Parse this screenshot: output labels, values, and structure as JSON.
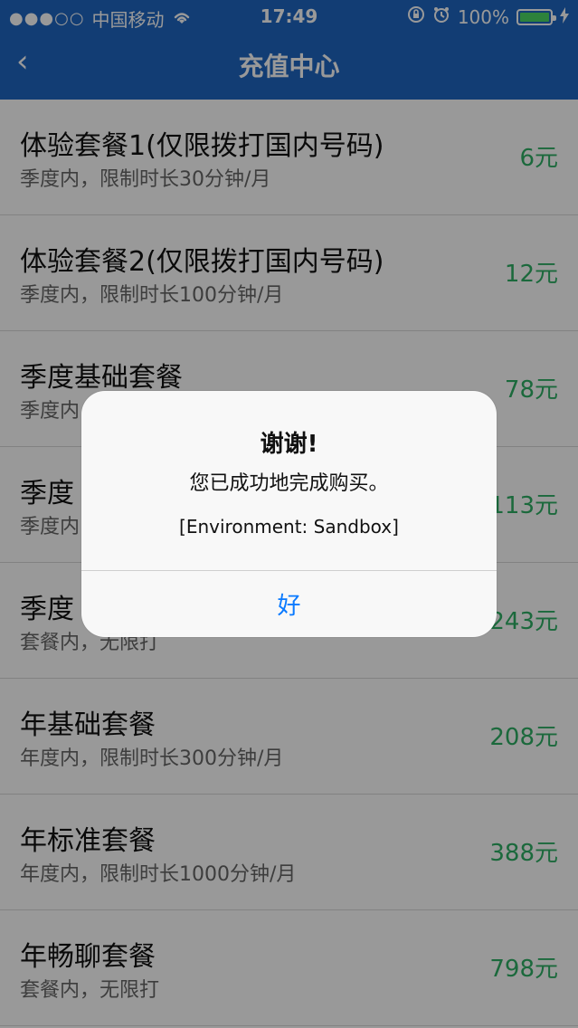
{
  "status_bar": {
    "signal_dots": "●●●○○",
    "carrier": "中国移动",
    "wifi_icon": "wifi-icon",
    "time": "17:49",
    "battery_percent": "100%",
    "battery_color": "#4cd964"
  },
  "nav": {
    "back_label": "‹",
    "title": "充值中心"
  },
  "plans": [
    {
      "name": "体验套餐1(仅限拨打国内号码)",
      "desc": "季度内，限制时长30分钟/月",
      "price": "6元"
    },
    {
      "name": "体验套餐2(仅限拨打国内号码)",
      "desc": "季度内，限制时长100分钟/月",
      "price": "12元"
    },
    {
      "name": "季度基础套餐",
      "desc": "季度内",
      "price": "78元"
    },
    {
      "name": "季度",
      "desc": "季度内",
      "price": "113元"
    },
    {
      "name": "季度",
      "desc": "套餐内，无限打",
      "price": "243元"
    },
    {
      "name": "年基础套餐",
      "desc": "年度内，限制时长300分钟/月",
      "price": "208元"
    },
    {
      "name": "年标准套餐",
      "desc": "年度内，限制时长1000分钟/月",
      "price": "388元"
    },
    {
      "name": "年畅聊套餐",
      "desc": "套餐内，无限打",
      "price": "798元"
    }
  ],
  "alert": {
    "title": "谢谢!",
    "message": "您已成功地完成购买。",
    "environment": "[Environment: Sandbox]",
    "ok_label": "好"
  },
  "colors": {
    "nav_blue": "#1f66c2",
    "price_green": "#2eaf64",
    "alert_button_blue": "#0a7aff"
  }
}
